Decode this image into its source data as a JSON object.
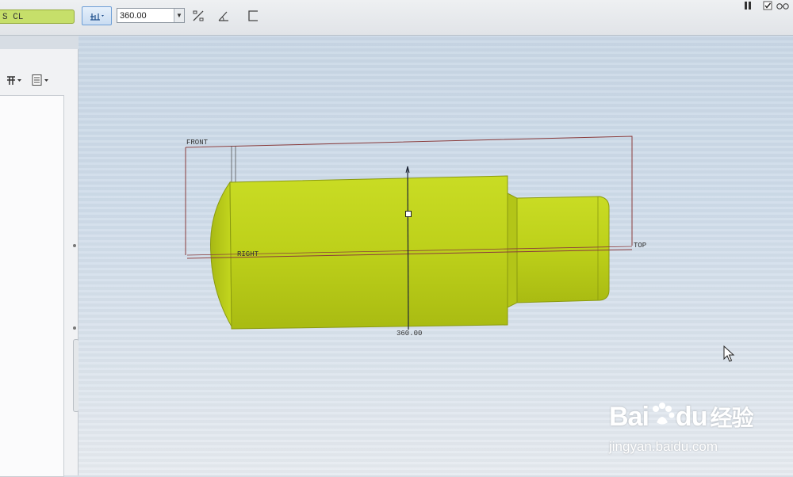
{
  "toolbar": {
    "feature_field_value": "S CL",
    "dimension_value": "360.00",
    "icons": [
      "dimension-type-icon",
      "dropdown-arrow-icon",
      "flip-ratio-icon",
      "angle-icon",
      "corner-icon"
    ]
  },
  "top_right": {
    "icons": [
      "pause-icon",
      "checkbox-icon",
      "glasses-icon"
    ],
    "checkbox_checked": true
  },
  "model_tree": {
    "icons": [
      "settings-icon",
      "show-icon"
    ]
  },
  "viewport": {
    "datum_planes": [
      "FRONT",
      "RIGHT",
      "TOP"
    ],
    "dimension_label": "360.00",
    "part_color": "#c4d81c",
    "edge_color": "#8a9a10",
    "datum_color": "#8a3c3c"
  },
  "watermark": {
    "brand_left": "Bai",
    "brand_right": "du",
    "brand_chinese": "经验",
    "site": "jingyan.baidu.com"
  }
}
